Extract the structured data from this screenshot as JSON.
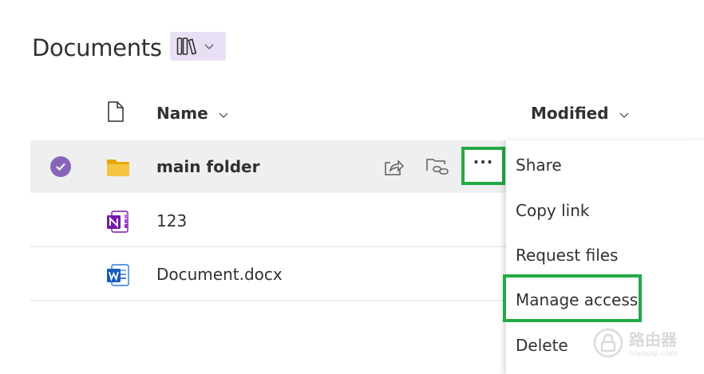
{
  "header": {
    "title": "Documents",
    "view_switcher_icon": "library-icon"
  },
  "columns": {
    "type_icon": "document-icon",
    "name": "Name",
    "modified": "Modified"
  },
  "rows": [
    {
      "name": "main folder",
      "icon": "folder-icon",
      "selected": true
    },
    {
      "name": "123",
      "icon": "onenote-icon",
      "selected": false
    },
    {
      "name": "Document.docx",
      "icon": "word-icon",
      "selected": false
    }
  ],
  "row_actions": {
    "share_icon": "share-icon",
    "copy_link_icon": "copy-link-icon",
    "more_label": "···"
  },
  "context_menu": {
    "items": [
      "Share",
      "Copy link",
      "Request files",
      "Manage access",
      "Delete"
    ]
  },
  "colors": {
    "accent": "#8764b8",
    "view_switcher_bg": "#e8dff5",
    "highlight": "#22aa44",
    "folder": "#f5c342",
    "selected_row": "#f0efef"
  },
  "watermark": {
    "text_cn": "路由器",
    "text_en": "luyouqi.com"
  }
}
